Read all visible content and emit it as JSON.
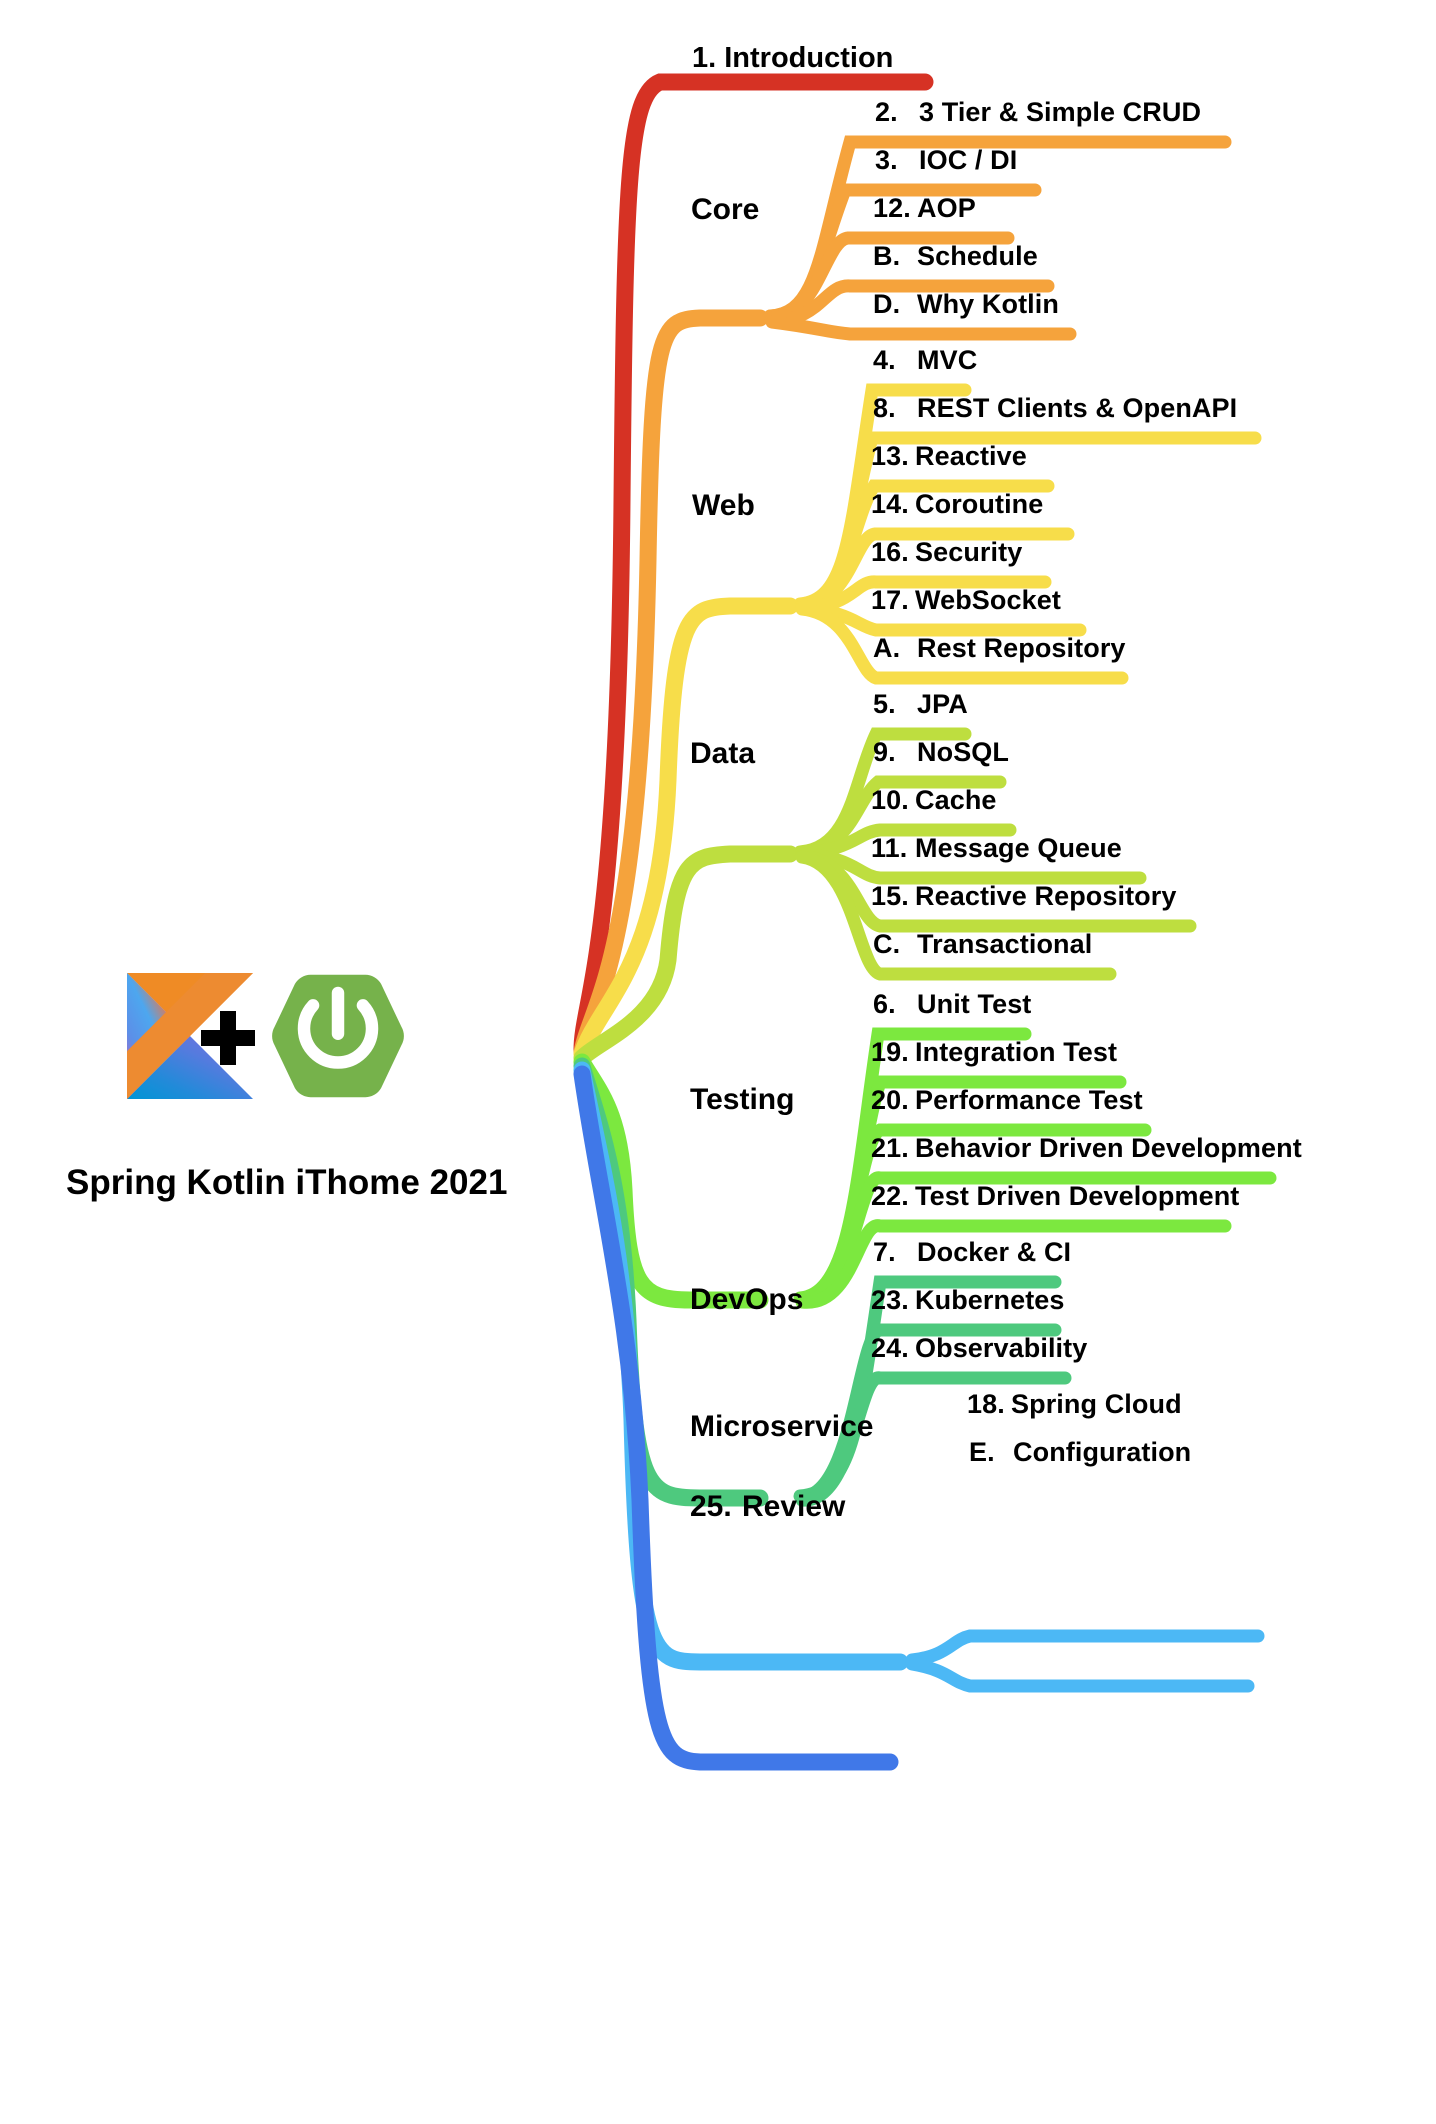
{
  "root": {
    "title": "Spring Kotlin iThome 2021",
    "logos": [
      "kotlin-logo",
      "spring-boot-logo"
    ],
    "plus_symbol": "+"
  },
  "colors": {
    "intro": "#d63224",
    "core": "#f5a33c",
    "web": "#f7dd4a",
    "data": "#bede3f",
    "testing": "#7ce83f",
    "devops": "#4ec97e",
    "microservice": "#4cb8f5",
    "review": "#4078e8",
    "text": "#000000",
    "background": "#ffffff"
  },
  "branches": [
    {
      "id": "introduction",
      "label": "1. Introduction",
      "number": "1.",
      "text": "Introduction",
      "color_key": "intro",
      "children": []
    },
    {
      "id": "core",
      "label": "Core",
      "color_key": "core",
      "children": [
        {
          "number": "2.",
          "text": "3 Tier & Simple CRUD"
        },
        {
          "number": "3.",
          "text": "IOC / DI"
        },
        {
          "number": "12.",
          "text": "AOP"
        },
        {
          "number": "B.",
          "text": "Schedule"
        },
        {
          "number": "D.",
          "text": "Why Kotlin"
        }
      ]
    },
    {
      "id": "web",
      "label": "Web",
      "color_key": "web",
      "children": [
        {
          "number": "4.",
          "text": "MVC"
        },
        {
          "number": "8.",
          "text": "REST Clients & OpenAPI"
        },
        {
          "number": "13.",
          "text": "Reactive"
        },
        {
          "number": "14.",
          "text": "Coroutine"
        },
        {
          "number": "16.",
          "text": "Security"
        },
        {
          "number": "17.",
          "text": "WebSocket"
        },
        {
          "number": "A.",
          "text": "Rest Repository"
        }
      ]
    },
    {
      "id": "data",
      "label": "Data",
      "color_key": "data",
      "children": [
        {
          "number": "5.",
          "text": "JPA"
        },
        {
          "number": "9.",
          "text": "NoSQL"
        },
        {
          "number": "10.",
          "text": "Cache"
        },
        {
          "number": "11.",
          "text": "Message Queue"
        },
        {
          "number": "15.",
          "text": "Reactive Repository"
        },
        {
          "number": "C.",
          "text": "Transactional"
        }
      ]
    },
    {
      "id": "testing",
      "label": "Testing",
      "color_key": "testing",
      "children": [
        {
          "number": "6.",
          "text": "Unit Test"
        },
        {
          "number": "19.",
          "text": "Integration Test"
        },
        {
          "number": "20.",
          "text": "Performance Test"
        },
        {
          "number": "21.",
          "text": "Behavior Driven Development"
        },
        {
          "number": "22.",
          "text": "Test Driven Development"
        }
      ]
    },
    {
      "id": "devops",
      "label": "DevOps",
      "color_key": "devops",
      "children": [
        {
          "number": "7.",
          "text": "Docker & CI"
        },
        {
          "number": "23.",
          "text": "Kubernetes"
        },
        {
          "number": "24.",
          "text": "Observability"
        }
      ]
    },
    {
      "id": "microservice",
      "label": "Microservice",
      "color_key": "microservice",
      "children": [
        {
          "number": "18.",
          "text": "Spring Cloud"
        },
        {
          "number": "E.",
          "text": "Configuration"
        }
      ]
    },
    {
      "id": "review",
      "label": "25. Review",
      "number": "25.",
      "text": "Review",
      "color_key": "review",
      "children": []
    }
  ]
}
